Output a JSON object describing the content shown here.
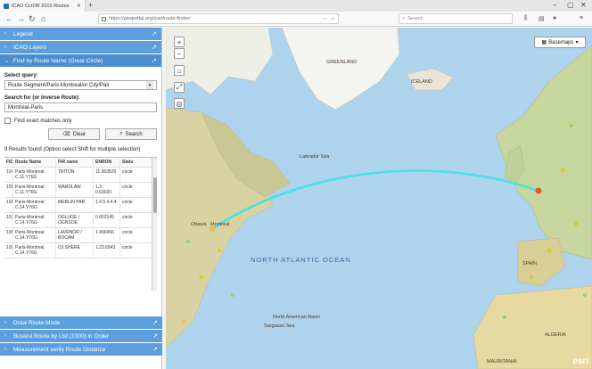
{
  "browser": {
    "tab_title": "ICAO CLIOR 2015 Routes",
    "url": "https://geoportal.org/icao/route-finder/",
    "search_placeholder": "Search"
  },
  "panel": {
    "sections": [
      {
        "label": "Legend"
      },
      {
        "label": "ICAO Layers"
      },
      {
        "label": "Find by Route Name (Great Circle)"
      }
    ],
    "select_query_label": "Select query:",
    "select_query_value": "Route Segment/Paris-Montreal/or City/Pair",
    "search_label": "Search for (or inverse Route):",
    "search_value": "Montreal-Paris",
    "exact_match_label": "Find exact matches only",
    "clear_label": "Clear",
    "search_button_label": "Search",
    "results_text": "9 Results found (Option select Shift for multiple selection)",
    "table": {
      "headers": [
        "FID",
        "Route Name",
        "FIR name",
        "ENRON",
        "Stats"
      ],
      "rows": [
        [
          "104",
          "Paris-Montreal C.11.Y76G",
          "TRITON",
          "11.963520",
          "circle"
        ],
        [
          "105",
          "Paris-Montreal C.11.Y76G",
          "WARDLAW",
          "1.3 0.63020",
          "circle"
        ],
        [
          "106",
          "Paris-Montreal C.14.Y76G",
          "MERLIN PAR",
          "1.4.5.4.4.4",
          "circle"
        ],
        [
          "107",
          "Paris-Montreal C.14.Y76G",
          "OGLUGE / OGNSOE",
          "0.652145",
          "circle"
        ],
        [
          "108",
          "Paris-Montreal C.14.Y76G",
          "LAVRNOR / BOCAM",
          "1.456456",
          "circle"
        ],
        [
          "109",
          "Paris-Montreal C.14.Y76G",
          "OJ SHERE",
          "1.23.6543",
          "circle"
        ]
      ]
    },
    "bottom_sections": [
      {
        "label": "Draw Route Mode"
      },
      {
        "label": "Busiest Route by List (1000) in Order"
      },
      {
        "label": "Measurement verify Route Distance"
      }
    ]
  },
  "map": {
    "basemap_label": "Basemaps",
    "ocean_label": "NORTH ATLANTIC OCEAN",
    "labels": {
      "greenland": "GREENLAND",
      "iceland": "ICELAND",
      "labrador_sea": "Labrador Sea",
      "ottawa": "Ottawa",
      "montreal": "Montreal",
      "spain": "SPAIN",
      "algeria": "ALGERIA",
      "mauritania": "MAURITANIA",
      "sargasso": "Sargasso Sea",
      "north_american_basin": "North American Basin"
    },
    "attribution": "esri",
    "route_color": "#46e0e6"
  }
}
